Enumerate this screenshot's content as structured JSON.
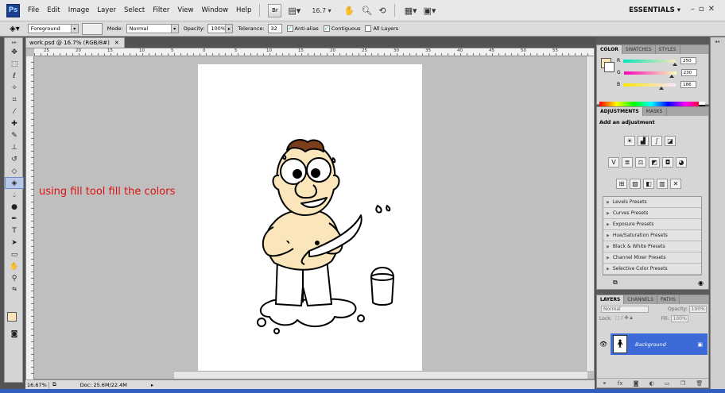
{
  "menubar": {
    "logo": "Ps",
    "items": [
      "File",
      "Edit",
      "Image",
      "Layer",
      "Select",
      "Filter",
      "View",
      "Window",
      "Help"
    ],
    "zoom": "16.7",
    "workspace": "ESSENTIALS"
  },
  "options": {
    "fill_source": "Foreground",
    "mode_label": "Mode:",
    "mode": "Normal",
    "opacity_label": "Opacity:",
    "opacity": "100%",
    "tolerance_label": "Tolerance:",
    "tolerance": "32",
    "antialias": "Anti-alias",
    "contiguous": "Contiguous",
    "all_layers": "All Layers"
  },
  "document": {
    "tab": "work.psd @ 16.7% (RGB/8#)",
    "annotation": "using fill tool fill the colors",
    "ruler": [
      "25",
      "20",
      "15",
      "10",
      "5",
      "0",
      "5",
      "10",
      "15",
      "20",
      "25",
      "30",
      "35",
      "40",
      "45",
      "50",
      "55"
    ]
  },
  "status": {
    "zoom": "16.67%",
    "doc_size": "Doc: 25.6M/22.4M"
  },
  "color_panel": {
    "tabs": [
      "COLOR",
      "SWATCHES",
      "STYLES"
    ],
    "channels": [
      {
        "label": "R",
        "value": "250"
      },
      {
        "label": "G",
        "value": "230"
      },
      {
        "label": "B",
        "value": "186"
      }
    ],
    "foreground": "#fae6ba"
  },
  "adjustments_panel": {
    "tabs": [
      "ADJUSTMENTS",
      "MASKS"
    ],
    "title": "Add an adjustment",
    "presets": [
      "Levels Presets",
      "Curves Presets",
      "Exposure Presets",
      "Hue/Saturation Presets",
      "Black & White Presets",
      "Channel Mixer Presets",
      "Selective Color Presets"
    ]
  },
  "layers_panel": {
    "tabs": [
      "LAYERS",
      "CHANNELS",
      "PATHS"
    ],
    "blend_mode": "Normal",
    "opacity_label": "Opacity:",
    "opacity": "100%",
    "lock_label": "Lock:",
    "fill_label": "Fill:",
    "fill": "100%",
    "layers": [
      {
        "name": "Background"
      }
    ]
  }
}
